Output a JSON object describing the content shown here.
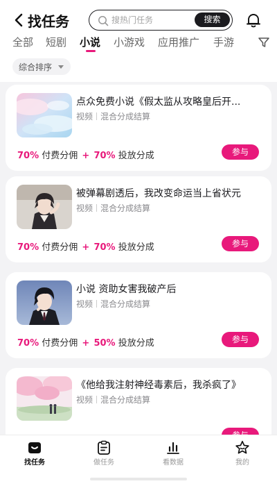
{
  "header": {
    "title": "找任务",
    "search_placeholder": "搜热门任务",
    "search_button": "搜索"
  },
  "tabs": [
    {
      "label": "全部"
    },
    {
      "label": "短剧"
    },
    {
      "label": "小说",
      "active": true
    },
    {
      "label": "小游戏"
    },
    {
      "label": "应用推广"
    },
    {
      "label": "手游"
    }
  ],
  "sort": {
    "label": "综合排序"
  },
  "tasks": [
    {
      "title": "点众免费小说《假太监从攻略皇后开...",
      "category": "视频",
      "settlement": "混合分成结算",
      "paid_share": "70%",
      "paid_label": "付费分佣",
      "plus": "+",
      "ad_share": "70%",
      "ad_label": "投放分成",
      "button": "参与",
      "thumb": "pastel-sky-clouds"
    },
    {
      "title": "被弹幕剧透后，我改变命运当上省状元",
      "category": "视频",
      "settlement": "混合分成结算",
      "paid_share": "70%",
      "paid_label": "付费分佣",
      "plus": "+",
      "ad_share": "70%",
      "ad_label": "投放分成",
      "button": "参与",
      "thumb": "young-man-portrait"
    },
    {
      "title": "小说 资助女害我破产后",
      "category": "视频",
      "settlement": "混合分成结算",
      "paid_share": "70%",
      "paid_label": "付费分佣",
      "plus": "+",
      "ad_share": "50%",
      "ad_label": "投放分成",
      "button": "参与",
      "thumb": "man-in-suit-portrait"
    },
    {
      "title": "《他给我注射神经毒素后，我杀疯了》",
      "category": "视频",
      "settlement": "混合分成结算",
      "paid_share": "",
      "paid_label": "",
      "plus": "",
      "ad_share": "",
      "ad_label": "",
      "button": "参与",
      "thumb": "cherry-blossom-couple"
    }
  ],
  "nav": [
    {
      "label": "找任务",
      "icon": "find-task-icon",
      "active": true
    },
    {
      "label": "做任务",
      "icon": "clipboard-icon"
    },
    {
      "label": "看数据",
      "icon": "bar-chart-icon"
    },
    {
      "label": "我的",
      "icon": "star-profile-icon"
    }
  ],
  "colors": {
    "accent": "#e8197b",
    "dark": "#1b1b1f",
    "background": "#f3f3f5"
  }
}
